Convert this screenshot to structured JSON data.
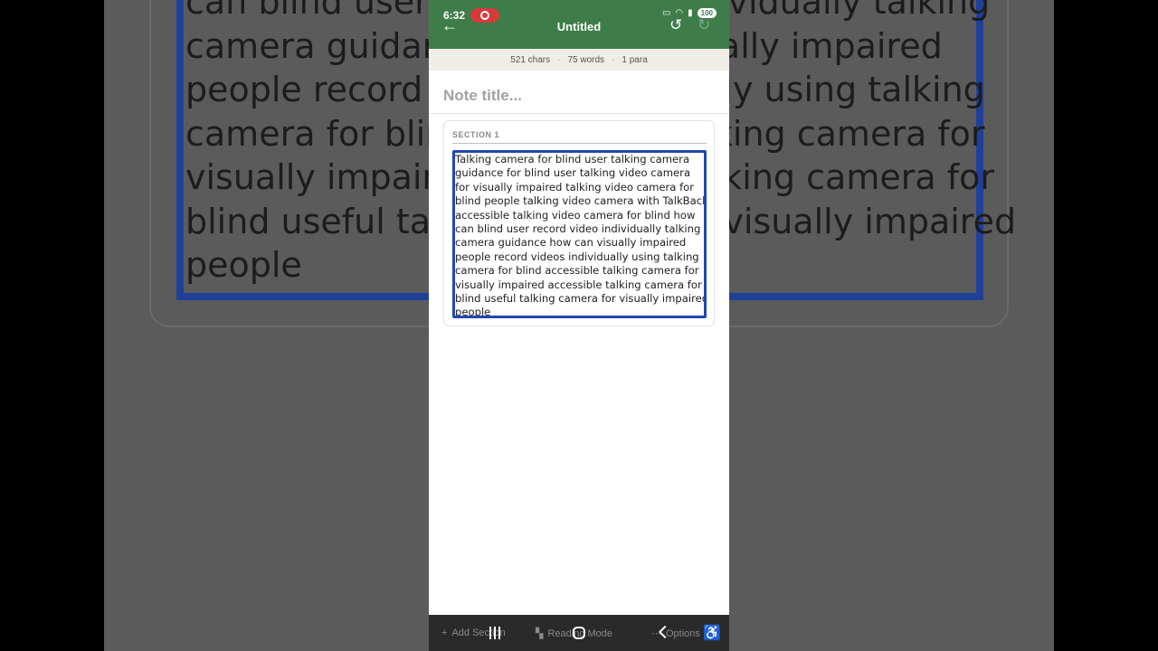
{
  "status": {
    "time": "6:32",
    "battery": "100",
    "icons": [
      "cast-icon",
      "wifi-icon",
      "signal-icon"
    ]
  },
  "appbar": {
    "title": "Untitled"
  },
  "stats": {
    "chars": "521 chars",
    "words": "75 words",
    "paras": "1 para"
  },
  "note": {
    "title_placeholder": "Note title..."
  },
  "section": {
    "label": "SECTION 1",
    "lines": [
      "Talking camera for blind user talking camera",
      "guidance for blind user talking video camera",
      "for visually impaired talking video camera for",
      "blind people talking video camera with TalkBack",
      "accessible talking video camera for blind how",
      "can blind user record video individually talking",
      "camera guidance how can visually impaired",
      "people record videos individually using talking",
      "camera for blind accessible talking camera for",
      "visually impaired accessible talking camera for",
      "blind useful talking camera for visually impaired",
      "people"
    ]
  },
  "backdrop": {
    "lines": [
      "can blind user record video individually talking",
      "camera guidance how can visually impaired",
      "people record videos individually using talking",
      "camera for blind accessible talking camera for",
      "visually impaired accessible talking camera for",
      "blind useful talking camera for visually impaired",
      "people"
    ]
  },
  "bottom_bar": {
    "add_section": "Add Section",
    "reading_mode": "Reading Mode",
    "options": "Options"
  },
  "colors": {
    "appbar": "#3e7d4a",
    "focus_border": "#2148b1",
    "stats_bg": "#efede6"
  }
}
